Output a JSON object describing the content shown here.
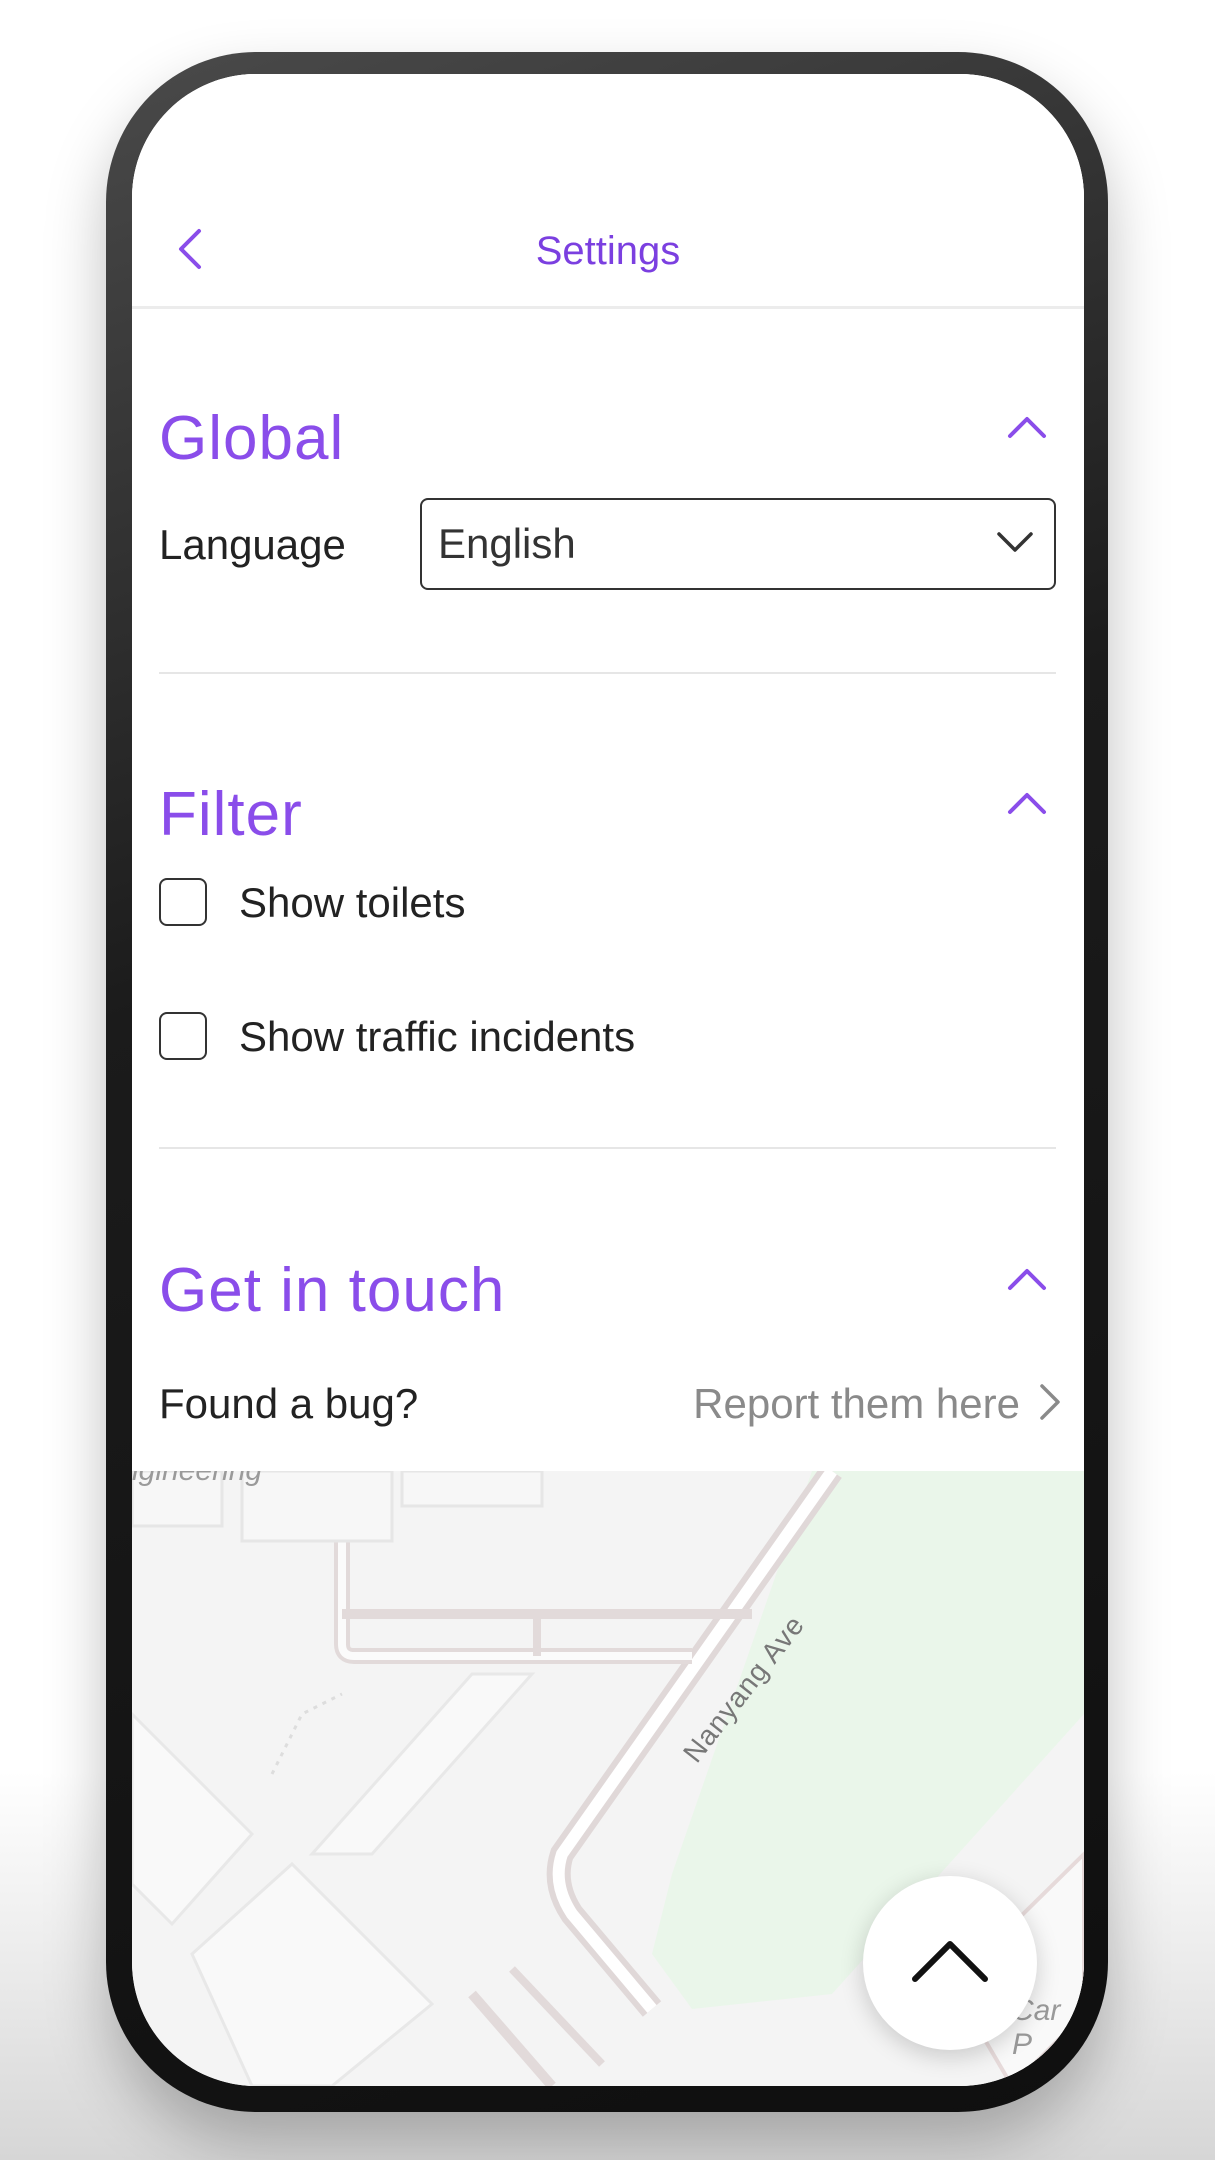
{
  "header": {
    "title": "Settings",
    "back_icon": "chevron-left-icon"
  },
  "sections": {
    "global": {
      "title": "Global",
      "toggle_icon": "chevron-up-icon",
      "language_label": "Language",
      "language_value": "English",
      "language_dropdown_icon": "chevron-down-icon"
    },
    "filter": {
      "title": "Filter",
      "toggle_icon": "chevron-up-icon",
      "options": [
        {
          "label": "Show toilets",
          "checked": false
        },
        {
          "label": "Show traffic incidents",
          "checked": false
        }
      ]
    },
    "contact": {
      "title": "Get in touch",
      "toggle_icon": "chevron-up-icon",
      "bug_label": "Found a bug?",
      "report_link": "Report them here",
      "report_icon": "chevron-right-icon"
    }
  },
  "map": {
    "road_label": "Nanyang Ave",
    "building_label_partial": "ngineering",
    "parking_label_partial": "Car P"
  },
  "fab": {
    "icon": "chevron-up-icon"
  },
  "colors": {
    "accent": "#8a4dea",
    "title": "#7b3fe0",
    "text": "#222222",
    "muted": "#8a8a8a"
  }
}
